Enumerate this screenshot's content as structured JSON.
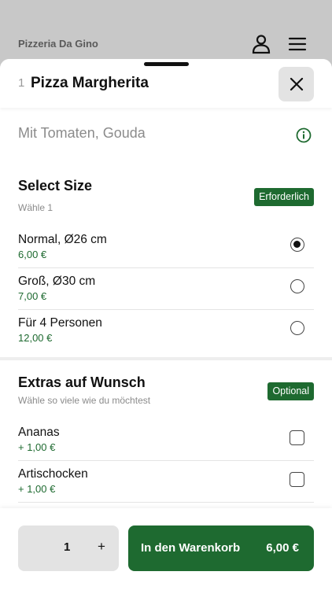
{
  "app": {
    "brand": "Pizzeria Da Gino"
  },
  "icons": {
    "user": "user-icon",
    "menu": "menu-icon",
    "close": "close-icon",
    "info": "info-icon"
  },
  "colors": {
    "accent": "#1e6a30",
    "backdrop": "#c8c8c8"
  },
  "item": {
    "qty_prefix": "1",
    "title": "Pizza Margherita",
    "description": "Mit Tomaten, Gouda"
  },
  "size_section": {
    "title": "Select Size",
    "subtitle": "Wähle 1",
    "badge": "Erforderlich",
    "options": [
      {
        "name": "Normal, Ø26 cm",
        "price": "6,00 €",
        "selected": true
      },
      {
        "name": "Groß, Ø30 cm",
        "price": "7,00 €",
        "selected": false
      },
      {
        "name": "Für 4 Personen",
        "price": "12,00 €",
        "selected": false
      }
    ]
  },
  "extras_section": {
    "title": "Extras auf Wunsch",
    "subtitle": "Wähle so viele wie du möchtest",
    "badge": "Optional",
    "options": [
      {
        "name": "Ananas",
        "price": "+ 1,00 €",
        "checked": false
      },
      {
        "name": "Artischocken",
        "price": "+ 1,00 €",
        "checked": false
      }
    ]
  },
  "footer": {
    "quantity": "1",
    "plus": "+",
    "add_to_cart": "In den Warenkorb",
    "total": "6,00 €"
  }
}
